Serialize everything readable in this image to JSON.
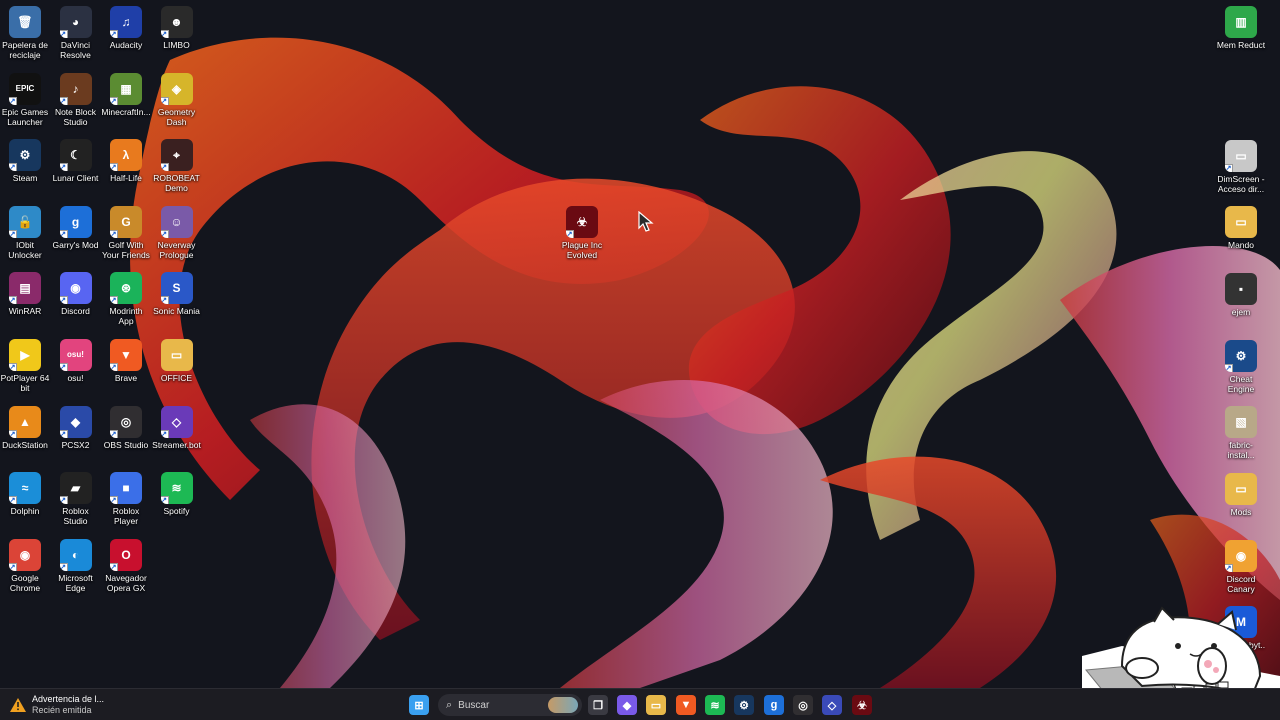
{
  "desktop": {
    "left_icons": [
      {
        "label": "Papelera de reciclaje",
        "icon": "recycle-bin-icon",
        "color": "#3a6ea8",
        "glyph": "🗑",
        "shortcut": false
      },
      {
        "label": "DaVinci Resolve",
        "icon": "davinci-resolve-icon",
        "color": "#2b3142",
        "glyph": "◕",
        "shortcut": true
      },
      {
        "label": "Audacity",
        "icon": "audacity-icon",
        "color": "#1f3fa8",
        "glyph": "♫",
        "shortcut": true
      },
      {
        "label": "LIMBO",
        "icon": "limbo-icon",
        "color": "#2a2a2a",
        "glyph": "☻",
        "shortcut": true
      },
      {
        "label": "Epic Games Launcher",
        "icon": "epic-games-icon",
        "color": "#111111",
        "glyph": "EPIC",
        "shortcut": true
      },
      {
        "label": "Note Block Studio",
        "icon": "note-block-icon",
        "color": "#6b3b1f",
        "glyph": "♪",
        "shortcut": true
      },
      {
        "label": "MinecraftIn...",
        "icon": "minecraft-icon",
        "color": "#5b8c32",
        "glyph": "▦",
        "shortcut": true
      },
      {
        "label": "Geometry Dash",
        "icon": "geometry-dash-icon",
        "color": "#d6b52a",
        "glyph": "◈",
        "shortcut": true
      },
      {
        "label": "Steam",
        "icon": "steam-icon",
        "color": "#17375e",
        "glyph": "⚙",
        "shortcut": true
      },
      {
        "label": "Lunar Client",
        "icon": "lunar-client-icon",
        "color": "#222222",
        "glyph": "☾",
        "shortcut": true
      },
      {
        "label": "Half-Life",
        "icon": "half-life-icon",
        "color": "#e87a1e",
        "glyph": "λ",
        "shortcut": true
      },
      {
        "label": "ROBOBEAT Demo",
        "icon": "robobeat-icon",
        "color": "#3a2020",
        "glyph": "⌖",
        "shortcut": true
      },
      {
        "label": "IObit Unlocker",
        "icon": "iobit-unlocker-icon",
        "color": "#2e8ac8",
        "glyph": "🔓",
        "shortcut": true
      },
      {
        "label": "Garry's Mod",
        "icon": "garrys-mod-icon",
        "color": "#1d6fd8",
        "glyph": "g",
        "shortcut": true
      },
      {
        "label": "Golf With Your Friends",
        "icon": "golf-with-friends-icon",
        "color": "#c98a2a",
        "glyph": "G",
        "shortcut": true
      },
      {
        "label": "Neverway Prologue",
        "icon": "neverway-icon",
        "color": "#7a5aa8",
        "glyph": "☺",
        "shortcut": true
      },
      {
        "label": "WinRAR",
        "icon": "winrar-icon",
        "color": "#8a2a6a",
        "glyph": "▤",
        "shortcut": true
      },
      {
        "label": "Discord",
        "icon": "discord-icon",
        "color": "#5865f2",
        "glyph": "◉",
        "shortcut": true
      },
      {
        "label": "Modrinth App",
        "icon": "modrinth-icon",
        "color": "#1bb35a",
        "glyph": "⊛",
        "shortcut": true
      },
      {
        "label": "Sonic Mania",
        "icon": "sonic-mania-icon",
        "color": "#2a58c8",
        "glyph": "S",
        "shortcut": true
      },
      {
        "label": "PotPlayer 64 bit",
        "icon": "potplayer-icon",
        "color": "#f0c81a",
        "glyph": "▶",
        "shortcut": true
      },
      {
        "label": "osu!",
        "icon": "osu-icon",
        "color": "#e2447e",
        "glyph": "osu!",
        "shortcut": true
      },
      {
        "label": "Brave",
        "icon": "brave-icon",
        "color": "#f05a22",
        "glyph": "▼",
        "shortcut": true
      },
      {
        "label": "OFFICE",
        "icon": "office-folder-icon",
        "color": "#e8b84a",
        "glyph": "▭",
        "shortcut": false
      },
      {
        "label": "DuckStation",
        "icon": "duckstation-icon",
        "color": "#e88a1a",
        "glyph": "▲",
        "shortcut": true
      },
      {
        "label": "PCSX2",
        "icon": "pcsx2-icon",
        "color": "#2a4aa8",
        "glyph": "◆",
        "shortcut": true
      },
      {
        "label": "OBS Studio",
        "icon": "obs-studio-icon",
        "color": "#302e31",
        "glyph": "◎",
        "shortcut": true
      },
      {
        "label": "Streamer.bot",
        "icon": "streamerbot-icon",
        "color": "#6a3ab8",
        "glyph": "◇",
        "shortcut": true
      },
      {
        "label": "Dolphin",
        "icon": "dolphin-icon",
        "color": "#1b8ed8",
        "glyph": "≈",
        "shortcut": true
      },
      {
        "label": "Roblox Studio",
        "icon": "roblox-studio-icon",
        "color": "#222222",
        "glyph": "▰",
        "shortcut": true
      },
      {
        "label": "Roblox Player",
        "icon": "roblox-player-icon",
        "color": "#3b6fe8",
        "glyph": "■",
        "shortcut": true
      },
      {
        "label": "Spotify",
        "icon": "spotify-icon",
        "color": "#1db954",
        "glyph": "≋",
        "shortcut": true
      },
      {
        "label": "Google Chrome",
        "icon": "chrome-icon",
        "color": "#db4437",
        "glyph": "◉",
        "shortcut": true
      },
      {
        "label": "Microsoft Edge",
        "icon": "edge-icon",
        "color": "#1a8ad8",
        "glyph": "◐",
        "shortcut": true
      },
      {
        "label": "Navegador Opera GX",
        "icon": "opera-gx-icon",
        "color": "#c8102e",
        "glyph": "O",
        "shortcut": true
      }
    ],
    "right_icons": [
      {
        "label": "Mem Reduct",
        "icon": "mem-reduct-icon",
        "color": "#2ea84a",
        "glyph": "▥",
        "shortcut": false
      },
      {
        "label": "DimScreen - Acceso dir...",
        "icon": "dimscreen-icon",
        "color": "#c8c8c8",
        "glyph": "▭",
        "shortcut": true
      },
      {
        "label": "Mando",
        "icon": "mando-folder-icon",
        "color": "#e8b84a",
        "glyph": "▭",
        "shortcut": false
      },
      {
        "label": "ejem",
        "icon": "ejem-icon",
        "color": "#333333",
        "glyph": "▪",
        "shortcut": false
      },
      {
        "label": "Cheat Engine",
        "icon": "cheat-engine-icon",
        "color": "#1a4a8a",
        "glyph": "⚙",
        "shortcut": true
      },
      {
        "label": "fabric-instal...",
        "icon": "fabric-installer-icon",
        "color": "#b8a888",
        "glyph": "▧",
        "shortcut": false
      },
      {
        "label": "Mods",
        "icon": "mods-folder-icon",
        "color": "#e8b84a",
        "glyph": "▭",
        "shortcut": false
      },
      {
        "label": "Discord Canary",
        "icon": "discord-canary-icon",
        "color": "#f0a232",
        "glyph": "◉",
        "shortcut": true
      },
      {
        "label": "Malwarebyt...",
        "icon": "malwarebytes-icon",
        "color": "#1a5ad8",
        "glyph": "M",
        "shortcut": true
      }
    ],
    "center_icon": {
      "label": "Plague Inc Evolved",
      "icon": "plague-inc-icon",
      "color": "#6a0a12",
      "glyph": "☣",
      "shortcut": true
    }
  },
  "taskbar": {
    "notification": {
      "title": "Advertencia de l...",
      "subtitle": "Recién emitida",
      "icon": "warning-icon"
    },
    "search_placeholder": "Buscar",
    "apps": [
      {
        "icon": "start-icon",
        "color": "#3aa0f0",
        "glyph": "⊞"
      },
      {
        "icon": "task-view-icon",
        "color": "#3a3a42",
        "glyph": "❐"
      },
      {
        "icon": "copilot-icon",
        "color": "#7a5ae8",
        "glyph": "◆"
      },
      {
        "icon": "file-explorer-icon",
        "color": "#e8b84a",
        "glyph": "▭"
      },
      {
        "icon": "brave-icon",
        "color": "#f05a22",
        "glyph": "▼"
      },
      {
        "icon": "spotify-icon",
        "color": "#1db954",
        "glyph": "≋"
      },
      {
        "icon": "steam-icon",
        "color": "#17375e",
        "glyph": "⚙"
      },
      {
        "icon": "garrys-mod-icon",
        "color": "#1d6fd8",
        "glyph": "g"
      },
      {
        "icon": "obs-studio-icon",
        "color": "#302e31",
        "glyph": "◎"
      },
      {
        "icon": "streamerbot-icon",
        "color": "#3a4ab8",
        "glyph": "◇"
      },
      {
        "icon": "plague-inc-icon",
        "color": "#6a0a12",
        "glyph": "☣"
      }
    ]
  }
}
